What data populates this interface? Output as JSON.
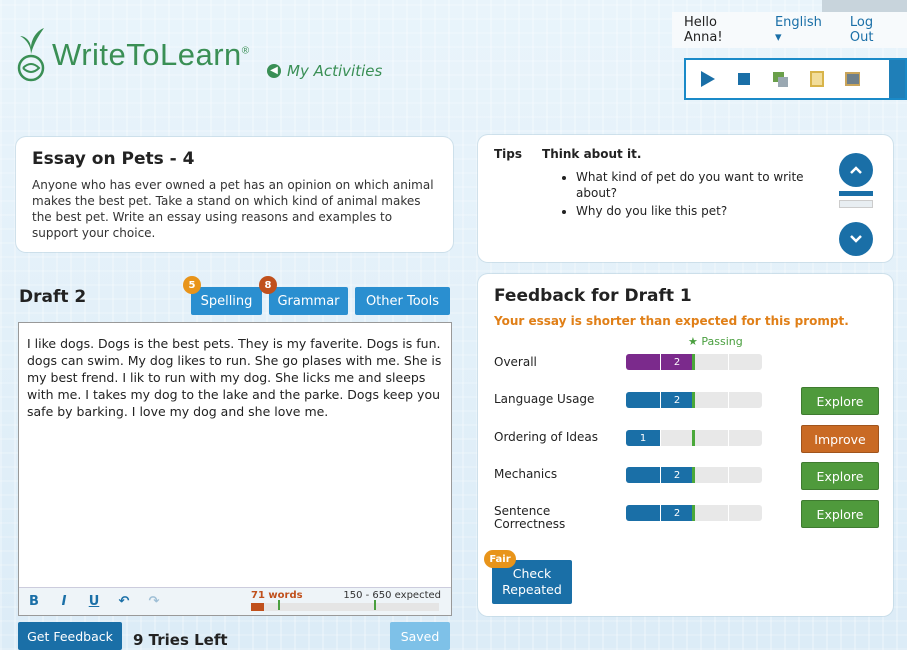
{
  "app": {
    "name_main": "WriteToLearn",
    "reg": "®",
    "my_activities": "My Activities"
  },
  "topbar": {
    "greeting": "Hello Anna!",
    "language": "English ▾",
    "logout": "Log Out"
  },
  "prompt": {
    "title": "Essay on Pets - 4",
    "text": "Anyone who has ever owned a pet has an opinion on which animal makes the best pet. Take a stand on which kind of animal makes the best pet. Write an essay using reasons and examples to support your choice."
  },
  "tips": {
    "label": "Tips",
    "heading": "Think about it.",
    "items": [
      "What kind of pet do you want to write about?",
      "Why do you like this pet?"
    ]
  },
  "draft": {
    "title": "Draft 2",
    "spelling_label": "Spelling",
    "spelling_count": "5",
    "grammar_label": "Grammar",
    "grammar_count": "8",
    "other_tools_label": "Other Tools",
    "essay_text": "I like dogs. Dogs is the best pets. They is my faverite. Dogs is fun. dogs can swim. My dog likes to run. She go plases with me. She is my best frend. I lik to run with my dog. She licks me and sleeps with me. I takes my dog to the lake and the parke. Dogs keep you safe by barking. I love my dog and she love me.",
    "word_count": "71 words",
    "expected": "150 - 650 expected",
    "word_progress": 0.07,
    "format": {
      "bold": "B",
      "italic": "I",
      "underline": "U",
      "undo": "↶",
      "redo": "↷"
    }
  },
  "footer": {
    "get_feedback": "Get Feedback",
    "tries": "9 Tries Left",
    "saved": "Saved"
  },
  "feedback": {
    "title": "Feedback for Draft 1",
    "warning": "Your essay is shorter than expected for this prompt.",
    "passing": "Passing",
    "traits": [
      {
        "name": "Overall",
        "score": "2",
        "action": ""
      },
      {
        "name": "Language Usage",
        "score": "2",
        "action": "Explore"
      },
      {
        "name": "Ordering of Ideas",
        "score": "1",
        "action": "Improve"
      },
      {
        "name": "Mechanics",
        "score": "2",
        "action": "Explore"
      },
      {
        "name": "Sentence Correctness",
        "score": "2",
        "action": "Explore"
      }
    ],
    "check_repeated": "Check Repeated",
    "fair": "Fair"
  },
  "colors": {
    "accent": "#1a6fa7",
    "brand_green": "#3a8f55",
    "overall_purple": "#7b2a8c",
    "warning_orange": "#e07f17"
  }
}
